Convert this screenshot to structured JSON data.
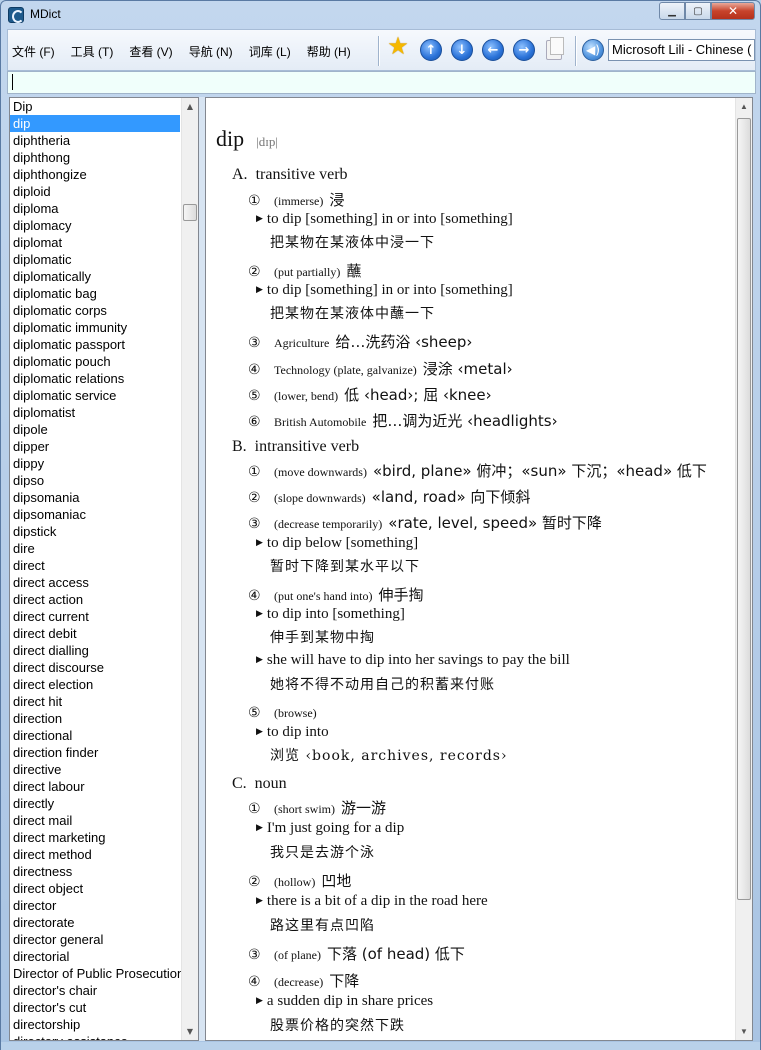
{
  "window": {
    "title": "MDict"
  },
  "menu": [
    "文件 (F)",
    "工具 (T)",
    "查看 (V)",
    "导航 (N)",
    "词库 (L)",
    "帮助 (H)"
  ],
  "toolbar": {
    "voice": "Microsoft Lili - Chinese ("
  },
  "search": {
    "value": ""
  },
  "wordlist": [
    "Dip",
    "dip",
    "diphtheria",
    "diphthong",
    "diphthongize",
    "diploid",
    "diploma",
    "diplomacy",
    "diplomat",
    "diplomatic",
    "diplomatically",
    "diplomatic bag",
    "diplomatic corps",
    "diplomatic immunity",
    "diplomatic passport",
    "diplomatic pouch",
    "diplomatic relations",
    "diplomatic service",
    "diplomatist",
    "dipole",
    "dipper",
    "dippy",
    "dipso",
    "dipsomania",
    "dipsomaniac",
    "dipstick",
    "dire",
    "direct",
    "direct access",
    "direct action",
    "direct current",
    "direct debit",
    "direct dialling",
    "direct discourse",
    "direct election",
    "direct hit",
    "direction",
    "directional",
    "direction finder",
    "directive",
    "direct labour",
    "directly",
    "direct mail",
    "direct marketing",
    "direct method",
    "directness",
    "direct object",
    "director",
    "directorate",
    "director general",
    "directorial",
    "Director of Public Prosecutions",
    "director's chair",
    "director's cut",
    "directorship",
    "directory assistance"
  ],
  "selected_index": 1,
  "entry": {
    "headword": "dip",
    "pron": "|dɪp|",
    "A": {
      "letter": "A.",
      "pos": "transitive verb"
    },
    "B": {
      "letter": "B.",
      "pos": "intransitive verb"
    },
    "C": {
      "letter": "C.",
      "pos": "noun"
    },
    "a1": {
      "num": "①",
      "lab": "(immerse)",
      "cn": "浸"
    },
    "a1e": "to dip [something] in or into [something]",
    "a1t": "把某物在某液体中浸一下",
    "a2": {
      "num": "②",
      "lab": "(put partially)",
      "cn": "蘸"
    },
    "a2e": "to dip [something] in or into [something]",
    "a2t": "把某物在某液体中蘸一下",
    "a3": {
      "num": "③",
      "lab": "Agriculture",
      "cn": "给…洗药浴 ‹sheep›"
    },
    "a4": {
      "num": "④",
      "lab": "Technology  (plate, galvanize)",
      "cn": "浸涂 ‹metal›"
    },
    "a5": {
      "num": "⑤",
      "lab": "(lower, bend)",
      "cn": "低 ‹head›; 屈 ‹knee›"
    },
    "a6": {
      "num": "⑥",
      "lab": "British Automobile",
      "cn": "把…调为近光 ‹headlights›"
    },
    "b1": {
      "num": "①",
      "lab": "(move downwards)",
      "cn": "«bird, plane» 俯冲；«sun» 下沉；«head» 低下"
    },
    "b2": {
      "num": "②",
      "lab": "(slope downwards)",
      "cn": "«land, road» 向下倾斜"
    },
    "b3": {
      "num": "③",
      "lab": "(decrease temporarily)",
      "cn": "«rate, level, speed» 暂时下降"
    },
    "b3e": "to dip below [something]",
    "b3t": "暂时下降到某水平以下",
    "b4": {
      "num": "④",
      "lab": "(put one's hand into)",
      "cn": "伸手掏"
    },
    "b4e": "to dip into [something]",
    "b4t": "伸手到某物中掏",
    "b4e2": "she will have to dip into her savings to pay the bill",
    "b4t2": "她将不得不动用自己的积蓄来付账",
    "b5": {
      "num": "⑤",
      "lab": "(browse)",
      "cn": ""
    },
    "b5e": "to dip into",
    "b5t": "浏览  ‹book, archives, records›",
    "c1": {
      "num": "①",
      "lab": "(short swim)",
      "cn": "游一游"
    },
    "c1e": "I'm just going for a dip",
    "c1t": "我只是去游个泳",
    "c2": {
      "num": "②",
      "lab": "(hollow)",
      "cn": "凹地"
    },
    "c2e": "there is a bit of a dip in the road here",
    "c2t": "路这里有点凹陷",
    "c3": {
      "num": "③",
      "lab": "(of plane)",
      "cn": "下落  (of head)  低下"
    },
    "c4": {
      "num": "④",
      "lab": "(decrease)",
      "cn": "下降"
    },
    "c4e": "a sudden dip in share prices",
    "c4t": "股票价格的突然下跌"
  }
}
